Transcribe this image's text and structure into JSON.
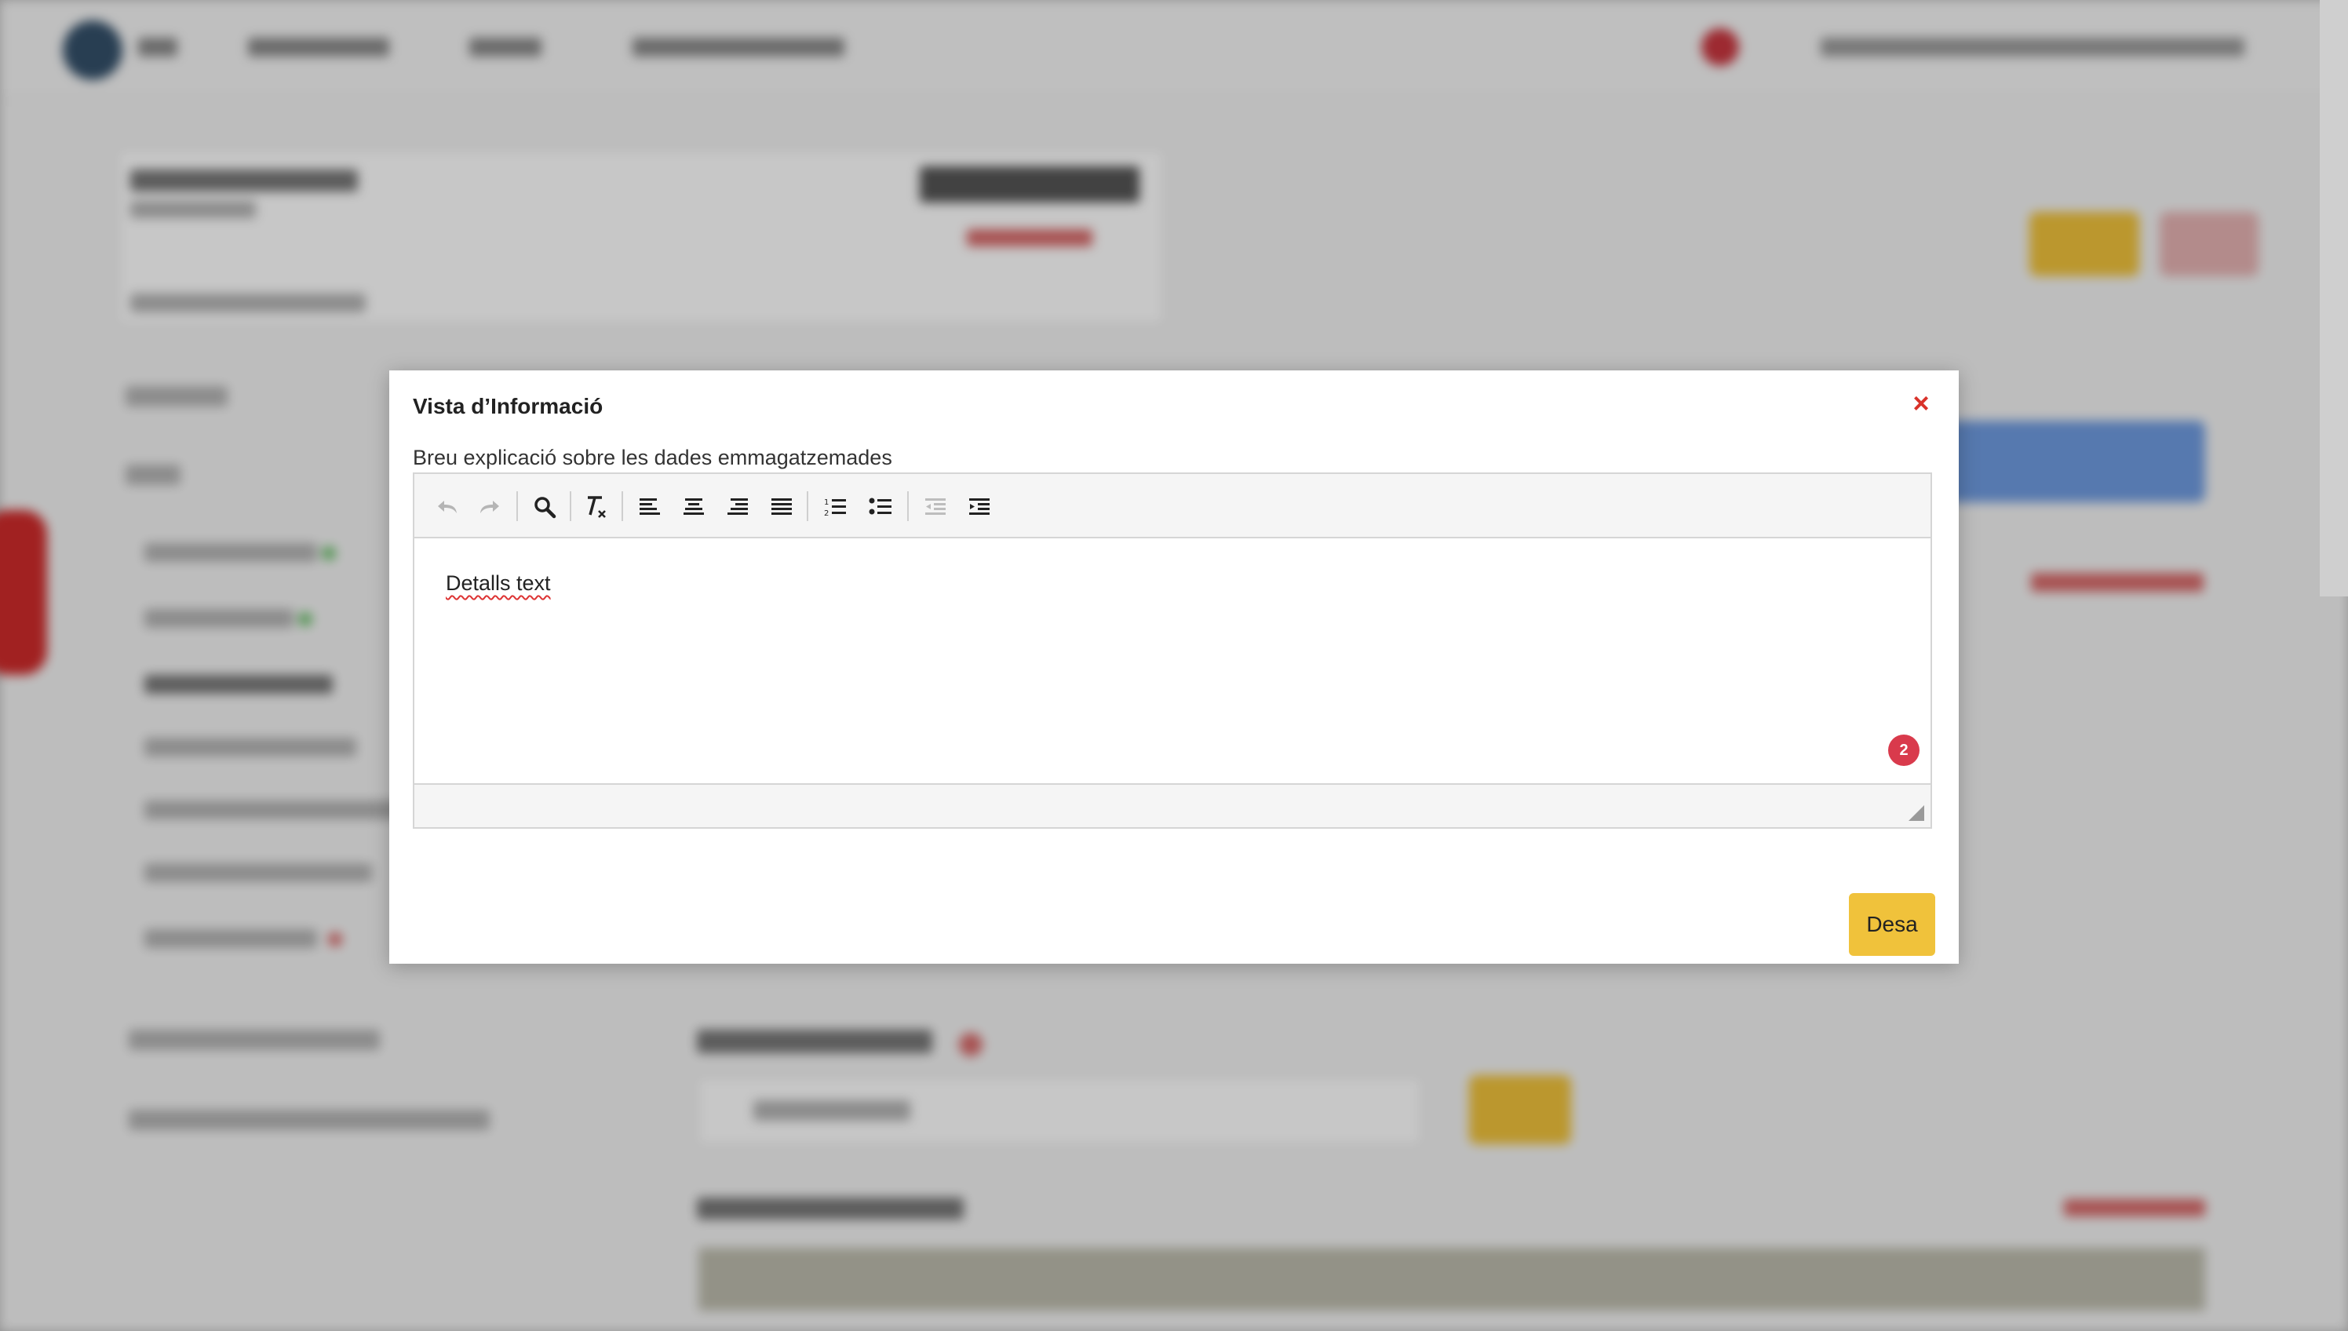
{
  "modal": {
    "title": "Vista d’Informació",
    "close_icon": "×",
    "description": "Breu explicació sobre les dades emmagatzemades",
    "editor": {
      "toolbar": [
        {
          "name": "undo-icon",
          "enabled": false
        },
        {
          "name": "redo-icon",
          "enabled": false
        },
        {
          "name": "search-icon",
          "enabled": true
        },
        {
          "name": "clear-formatting-icon",
          "enabled": true
        },
        {
          "name": "align-left-icon",
          "enabled": true
        },
        {
          "name": "align-center-icon",
          "enabled": true
        },
        {
          "name": "align-right-icon",
          "enabled": true
        },
        {
          "name": "align-justify-icon",
          "enabled": true
        },
        {
          "name": "numbered-list-icon",
          "enabled": true
        },
        {
          "name": "bullet-list-icon",
          "enabled": true
        },
        {
          "name": "outdent-icon",
          "enabled": false
        },
        {
          "name": "indent-icon",
          "enabled": true
        }
      ],
      "content": "Detalls text",
      "badge_count": "2"
    },
    "save_label": "Desa"
  },
  "colors": {
    "accent_yellow": "#f0c23b",
    "close_red": "#d9322a",
    "badge_red": "#d93a4c"
  }
}
